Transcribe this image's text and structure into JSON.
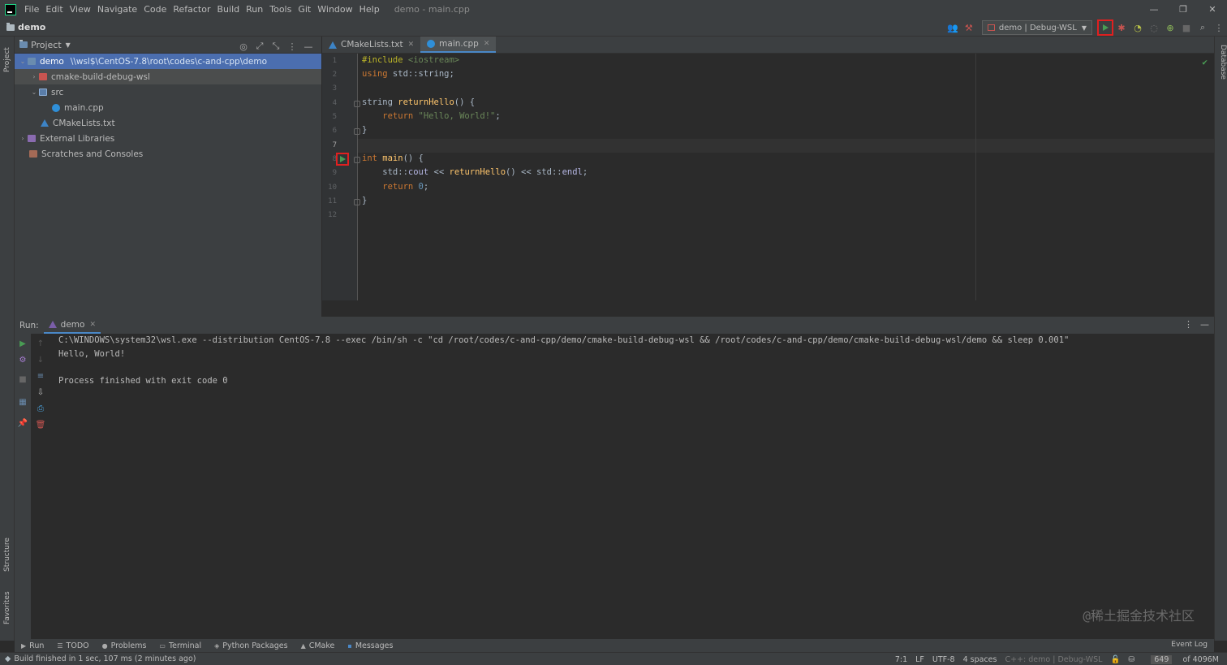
{
  "window": {
    "title": "demo - main.cpp",
    "menu": [
      "File",
      "Edit",
      "View",
      "Navigate",
      "Code",
      "Refactor",
      "Build",
      "Run",
      "Tools",
      "Git",
      "Window",
      "Help"
    ],
    "minimize": "—",
    "restore": "❐",
    "close": "✕"
  },
  "nav": {
    "project_name": "demo",
    "run_config": "demo | Debug-WSL"
  },
  "project_panel": {
    "title": "Project",
    "tree": [
      {
        "label": "demo",
        "path": "\\\\wsl$\\CentOS-7.8\\root\\codes\\c-and-cpp\\demo"
      },
      {
        "label": "cmake-build-debug-wsl"
      },
      {
        "label": "src"
      },
      {
        "label": "main.cpp"
      },
      {
        "label": "CMakeLists.txt"
      },
      {
        "label": "External Libraries"
      },
      {
        "label": "Scratches and Consoles"
      }
    ]
  },
  "left_strip": {
    "project_tab": "Project",
    "structure_tab": "Structure",
    "favorites_tab": "Favorites"
  },
  "right_strip": {
    "database_tab": "Database"
  },
  "editor": {
    "tabs": [
      {
        "label": "CMakeLists.txt"
      },
      {
        "label": "main.cpp"
      }
    ],
    "line_numbers": [
      "1",
      "2",
      "3",
      "4",
      "5",
      "6",
      "7",
      "8",
      "9",
      "10",
      "11",
      "12"
    ],
    "code": {
      "l1_kw": "#include",
      "l1_inc": " <iostream>",
      "l2_kw": "using",
      "l2_rest": " std::string;",
      "l4_type": "string",
      "l4_fn": " returnHello",
      "l4_rest": "() {",
      "l5_kw": "    return",
      "l5_str": " \"Hello, World!\"",
      "l5_rest": ";",
      "l6": "}",
      "l8_kw": "int",
      "l8_fn": " main",
      "l8_rest": "() {",
      "l9_ns": "    std::",
      "l9_cout": "cout",
      "l9_op1": " << ",
      "l9_call": "returnHello",
      "l9_op2": "() << ",
      "l9_ns2": "std::",
      "l9_endl": "endl",
      "l9_end": ";",
      "l10_kw": "    return",
      "l10_num": " 0",
      "l10_rest": ";",
      "l11": "}"
    }
  },
  "run_panel": {
    "label": "Run:",
    "tab": "demo",
    "output": [
      "C:\\WINDOWS\\system32\\wsl.exe --distribution CentOS-7.8 --exec /bin/sh -c \"cd /root/codes/c-and-cpp/demo/cmake-build-debug-wsl && /root/codes/c-and-cpp/demo/cmake-build-debug-wsl/demo && sleep 0.001\"",
      "Hello, World!",
      "",
      "Process finished with exit code 0"
    ]
  },
  "bottom_tabs": [
    {
      "label": "Run",
      "icon": "▶"
    },
    {
      "label": "TODO",
      "icon": "☰"
    },
    {
      "label": "Problems",
      "icon": "●"
    },
    {
      "label": "Terminal",
      "icon": "▭"
    },
    {
      "label": "Python Packages",
      "icon": "◈"
    },
    {
      "label": "CMake",
      "icon": "▲"
    },
    {
      "label": "Messages",
      "icon": "▪"
    }
  ],
  "event_log": "Event Log",
  "status": {
    "message": "Build finished in 1 sec, 107 ms (2 minutes ago)",
    "position": "7:1",
    "line_sep": "LF",
    "encoding": "UTF-8",
    "indent": "4 spaces",
    "context": "C++: demo | Debug-WSL",
    "memory_used": "649",
    "memory_total": "of 4096M"
  },
  "watermark": "@稀土掘金技术社区"
}
